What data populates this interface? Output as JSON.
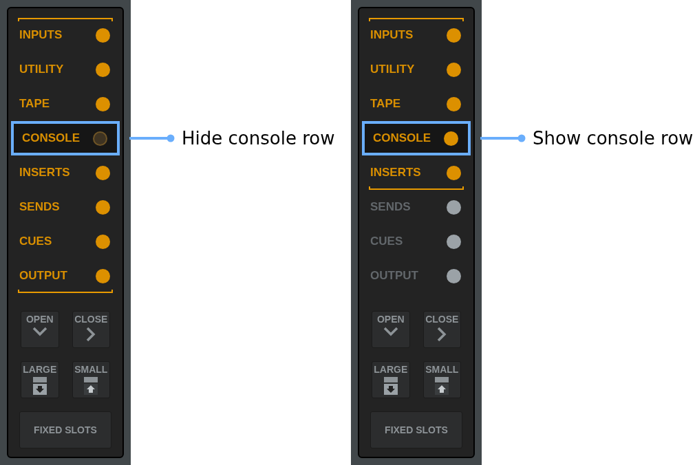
{
  "panels": [
    {
      "rows": [
        {
          "label": "INPUTS",
          "in_range": true,
          "visible": true
        },
        {
          "label": "UTILITY",
          "in_range": true,
          "visible": true
        },
        {
          "label": "TAPE",
          "in_range": true,
          "visible": true
        },
        {
          "label": "CONSOLE",
          "in_range": true,
          "visible": false,
          "callout": "Hide console row"
        },
        {
          "label": "INSERTS",
          "in_range": true,
          "visible": true
        },
        {
          "label": "SENDS",
          "in_range": true,
          "visible": true
        },
        {
          "label": "CUES",
          "in_range": true,
          "visible": true
        },
        {
          "label": "OUTPUT",
          "in_range": true,
          "visible": true
        }
      ],
      "buttons": [
        {
          "label": "OPEN",
          "kind": "open"
        },
        {
          "label": "CLOSE",
          "kind": "close"
        },
        {
          "label": "LARGE",
          "kind": "large"
        },
        {
          "label": "SMALL",
          "kind": "small"
        },
        {
          "label": "FIXED SLOTS",
          "kind": "wide"
        }
      ]
    },
    {
      "rows": [
        {
          "label": "INPUTS",
          "in_range": true,
          "visible": true
        },
        {
          "label": "UTILITY",
          "in_range": true,
          "visible": true
        },
        {
          "label": "TAPE",
          "in_range": true,
          "visible": true
        },
        {
          "label": "CONSOLE",
          "in_range": true,
          "visible": true,
          "callout": "Show console row"
        },
        {
          "label": "INSERTS",
          "in_range": true,
          "visible": true
        },
        {
          "label": "SENDS",
          "in_range": false,
          "visible": true
        },
        {
          "label": "CUES",
          "in_range": false,
          "visible": true
        },
        {
          "label": "OUTPUT",
          "in_range": false,
          "visible": true
        }
      ],
      "buttons": [
        {
          "label": "OPEN",
          "kind": "open"
        },
        {
          "label": "CLOSE",
          "kind": "close"
        },
        {
          "label": "LARGE",
          "kind": "large"
        },
        {
          "label": "SMALL",
          "kind": "small"
        },
        {
          "label": "FIXED SLOTS",
          "kind": "wide"
        }
      ]
    }
  ]
}
